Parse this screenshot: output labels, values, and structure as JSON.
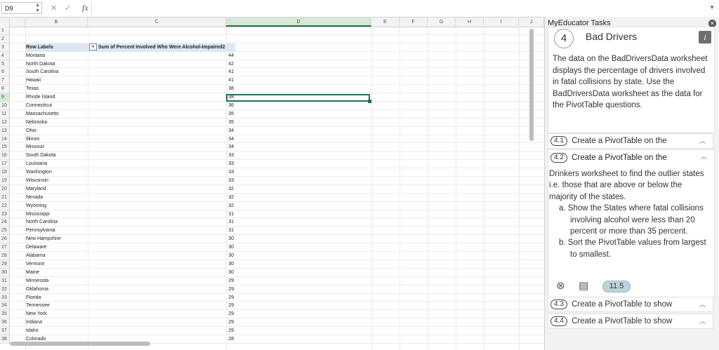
{
  "formula_bar": {
    "name_box": "D9",
    "cancel_icon": "✕",
    "enter_icon": "✓",
    "fx_label": "fx",
    "formula": ""
  },
  "columns": [
    "B",
    "C",
    "D",
    "E",
    "F",
    "G",
    "H",
    "I",
    "J"
  ],
  "row_numbers": [
    "1",
    "2",
    "3",
    "4",
    "5",
    "6",
    "7",
    "8",
    "9",
    "10",
    "11",
    "12",
    "13",
    "14",
    "15",
    "16",
    "17",
    "18",
    "19",
    "20",
    "21",
    "22",
    "23",
    "24",
    "25",
    "26",
    "27",
    "28",
    "29",
    "30",
    "31",
    "32",
    "33",
    "34",
    "35",
    "36",
    "37",
    "38"
  ],
  "pivot": {
    "header_labels": "Row Labels",
    "header_values": "Sum of Percent Involved Who Were Alcohol-Impaired2",
    "rows": [
      {
        "state": "Montana",
        "value": "44"
      },
      {
        "state": "North Dakota",
        "value": "42"
      },
      {
        "state": "South Carolina",
        "value": "41"
      },
      {
        "state": "Hawaii",
        "value": "41"
      },
      {
        "state": "Texas",
        "value": "38"
      },
      {
        "state": "Rhode Island",
        "value": "38"
      },
      {
        "state": "Connecticut",
        "value": "36"
      },
      {
        "state": "Massachusetts",
        "value": "35"
      },
      {
        "state": "Nebraska",
        "value": "35"
      },
      {
        "state": "Ohio",
        "value": "34"
      },
      {
        "state": "Illinois",
        "value": "34"
      },
      {
        "state": "Missouri",
        "value": "34"
      },
      {
        "state": "South Dakota",
        "value": "33"
      },
      {
        "state": "Louisiana",
        "value": "33"
      },
      {
        "state": "Washington",
        "value": "33"
      },
      {
        "state": "Wisconsin",
        "value": "33"
      },
      {
        "state": "Maryland",
        "value": "32"
      },
      {
        "state": "Nevada",
        "value": "32"
      },
      {
        "state": "Wyoming",
        "value": "32"
      },
      {
        "state": "Mississippi",
        "value": "31"
      },
      {
        "state": "North Carolina",
        "value": "31"
      },
      {
        "state": "Pennsylvania",
        "value": "31"
      },
      {
        "state": "New Hampshire",
        "value": "30"
      },
      {
        "state": "Delaware",
        "value": "30"
      },
      {
        "state": "Alabama",
        "value": "30"
      },
      {
        "state": "Vermont",
        "value": "30"
      },
      {
        "state": "Maine",
        "value": "30"
      },
      {
        "state": "Minnesota",
        "value": "29"
      },
      {
        "state": "Oklahoma",
        "value": "29"
      },
      {
        "state": "Florida",
        "value": "29"
      },
      {
        "state": "Tennessee",
        "value": "29"
      },
      {
        "state": "New York",
        "value": "29"
      },
      {
        "state": "Indiana",
        "value": "29"
      },
      {
        "state": "Idaho",
        "value": "29"
      },
      {
        "state": "Colorado",
        "value": "28"
      }
    ]
  },
  "panel": {
    "title": "MyEducator Tasks",
    "task_number": "4",
    "task_name": "Bad Drivers",
    "info_icon": "i",
    "description": "The data on the BadDriversData worksheet displays the percentage of drivers involved in fatal collisions by state. Use the BadDriversData worksheet as the data for the PivotTable questions.",
    "subtasks": [
      {
        "badge": "4.1",
        "label": "Create a PivotTable on the"
      },
      {
        "badge": "4.2",
        "label": "Create a PivotTable on the"
      },
      {
        "badge": "4.3",
        "label": "Create a PivotTable to show"
      },
      {
        "badge": "4.4",
        "label": "Create a PivotTable to show"
      }
    ],
    "task42_body": "Drinkers worksheet to find the outlier states i.e. those that are above or below the majority of the states.",
    "task42_a": "a.  Show the States where fatal collisions involving alcohol were less than 20 percent or more than 35 percent.",
    "task42_b": "b.  Sort the PivotTable values from largest to smallest.",
    "score": "11.5"
  }
}
